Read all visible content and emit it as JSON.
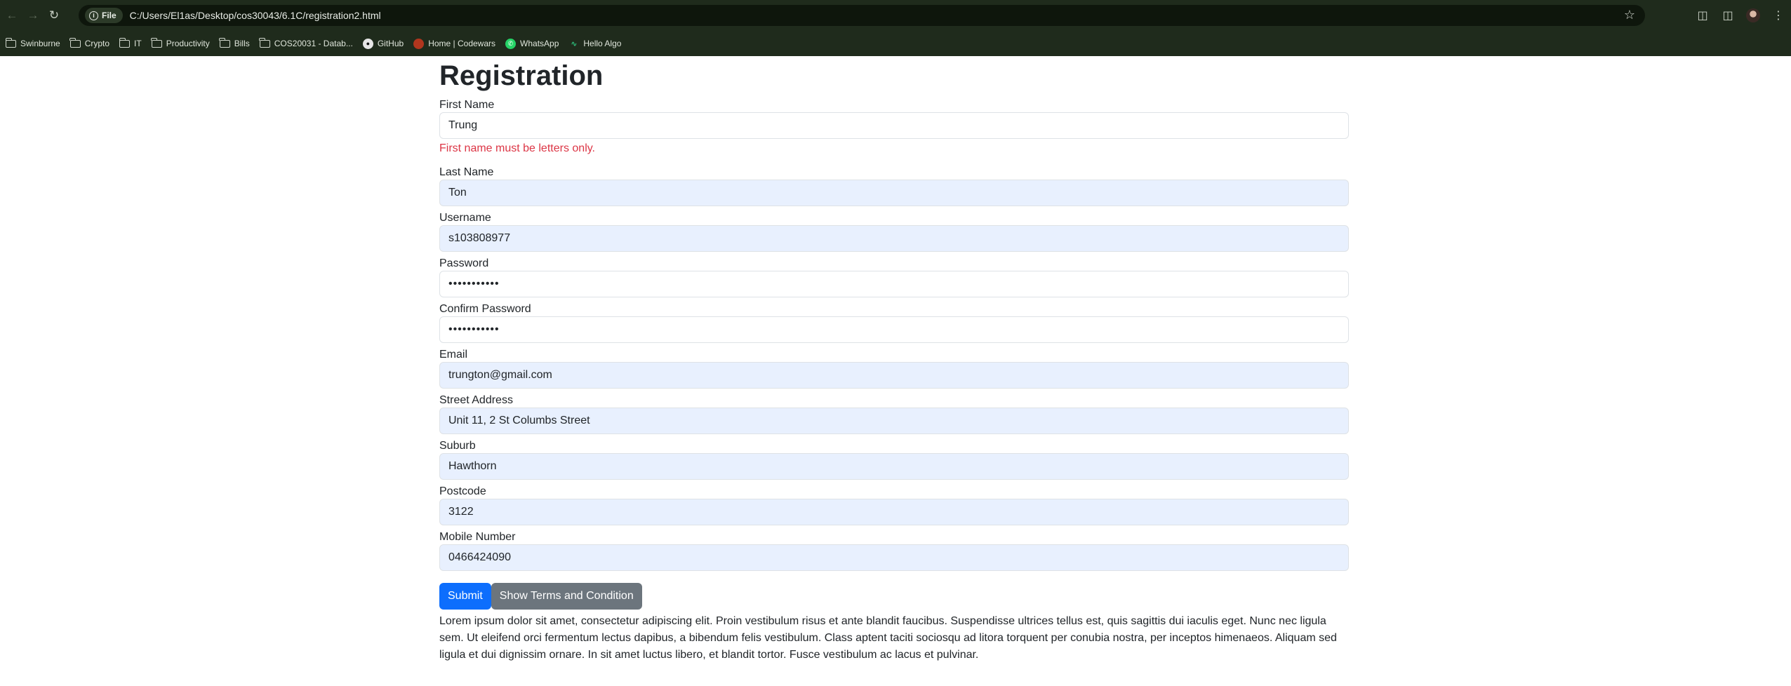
{
  "browser": {
    "chip_label": "File",
    "url": "C:/Users/El1as/Desktop/cos30043/6.1C/registration2.html",
    "bookmarks": [
      {
        "label": "Swinburne",
        "icon": "folder-icon"
      },
      {
        "label": "Crypto",
        "icon": "folder-icon"
      },
      {
        "label": "IT",
        "icon": "folder-icon"
      },
      {
        "label": "Productivity",
        "icon": "folder-icon"
      },
      {
        "label": "Bills",
        "icon": "folder-icon"
      },
      {
        "label": "COS20031 - Datab...",
        "icon": "folder-icon"
      },
      {
        "label": "GitHub",
        "icon": "github-icon"
      },
      {
        "label": "Home | Codewars",
        "icon": "codewars-icon"
      },
      {
        "label": "WhatsApp",
        "icon": "whatsapp-icon"
      },
      {
        "label": "Hello Algo",
        "icon": "hello-algo-icon"
      }
    ]
  },
  "form": {
    "title": "Registration",
    "first_name": {
      "label": "First Name",
      "value": "Trung",
      "error": "First name must be letters only."
    },
    "last_name": {
      "label": "Last Name",
      "value": "Ton"
    },
    "username": {
      "label": "Username",
      "value": "s103808977"
    },
    "password": {
      "label": "Password",
      "value": "•••••••••••"
    },
    "confirm_password": {
      "label": "Confirm Password",
      "value": "•••••••••••"
    },
    "email": {
      "label": "Email",
      "value": "trungton@gmail.com"
    },
    "street": {
      "label": "Street Address",
      "value": "Unit 11, 2 St Columbs Street"
    },
    "suburb": {
      "label": "Suburb",
      "value": "Hawthorn"
    },
    "postcode": {
      "label": "Postcode",
      "value": "3122"
    },
    "mobile": {
      "label": "Mobile Number",
      "value": "0466424090"
    },
    "submit_label": "Submit",
    "terms_button_label": "Show Terms and Condition",
    "terms_text": "Lorem ipsum dolor sit amet, consectetur adipiscing elit. Proin vestibulum risus et ante blandit faucibus. Suspendisse ultrices tellus est, quis sagittis dui iaculis eget. Nunc nec ligula sem. Ut eleifend orci fermentum lectus dapibus, a bibendum felis vestibulum. Class aptent taciti sociosqu ad litora torquent per conubia nostra, per inceptos himenaeos. Aliquam sed ligula et dui dignissim ornare. In sit amet luctus libero, et blandit tortor. Fusce vestibulum ac lacus et pulvinar."
  },
  "colors": {
    "chrome": "#1f2b1c",
    "primary": "#0d6efd",
    "secondary": "#6c757d",
    "error": "#dc3545",
    "autofill": "#e8f0fe"
  }
}
